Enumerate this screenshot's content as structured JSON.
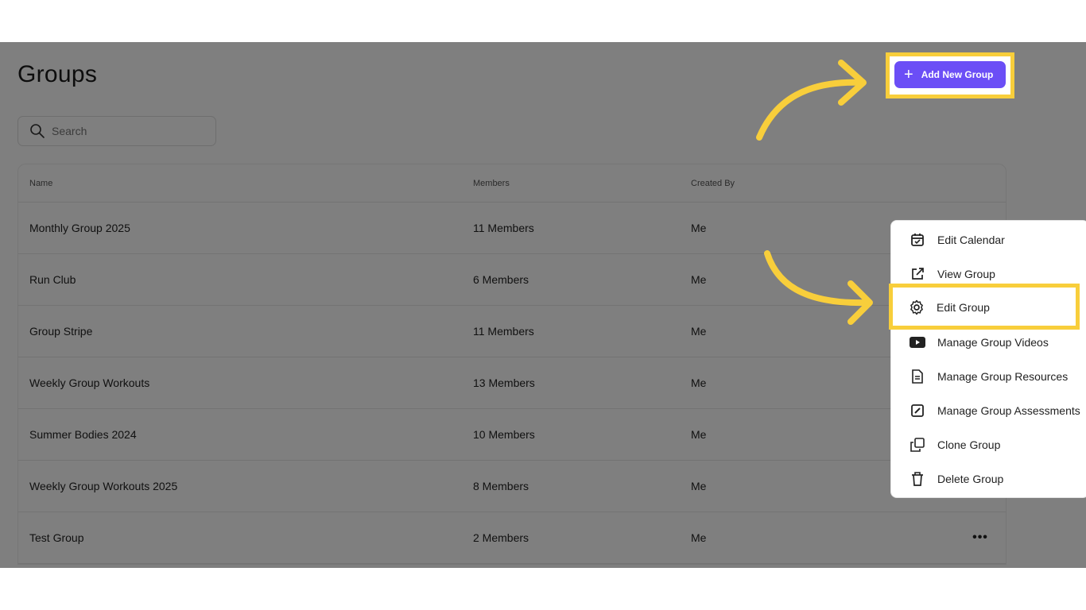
{
  "page": {
    "title": "Groups"
  },
  "toolbar": {
    "add_button_label": "Add New Group"
  },
  "search": {
    "placeholder": "Search",
    "value": ""
  },
  "table": {
    "headers": {
      "name": "Name",
      "members": "Members",
      "created_by": "Created By"
    },
    "rows": [
      {
        "name": "Monthly Group 2025",
        "members": "11 Members",
        "created_by": "Me"
      },
      {
        "name": "Run Club",
        "members": "6 Members",
        "created_by": "Me"
      },
      {
        "name": "Group Stripe",
        "members": "11 Members",
        "created_by": "Me"
      },
      {
        "name": "Weekly Group Workouts",
        "members": "13 Members",
        "created_by": "Me"
      },
      {
        "name": "Summer Bodies 2024",
        "members": "10 Members",
        "created_by": "Me"
      },
      {
        "name": "Weekly Group Workouts 2025",
        "members": "8 Members",
        "created_by": "Me"
      },
      {
        "name": "Test Group",
        "members": "2 Members",
        "created_by": "Me",
        "actions": "•••"
      }
    ]
  },
  "context_menu": {
    "items": [
      {
        "label": "Edit Calendar",
        "icon": "calendar-icon"
      },
      {
        "label": "View Group",
        "icon": "external-link-icon"
      },
      {
        "label": "Edit Group",
        "icon": "gear-icon"
      },
      {
        "label": "Manage Group Videos",
        "icon": "video-icon"
      },
      {
        "label": "Manage Group Resources",
        "icon": "document-icon"
      },
      {
        "label": "Manage Group Assessments",
        "icon": "edit-square-icon"
      },
      {
        "label": "Clone Group",
        "icon": "copy-icon"
      },
      {
        "label": "Delete Group",
        "icon": "trash-icon"
      }
    ]
  },
  "colors": {
    "accent": "#6b4ef6",
    "highlight": "#f8ce3b",
    "overlay": "#000000"
  }
}
